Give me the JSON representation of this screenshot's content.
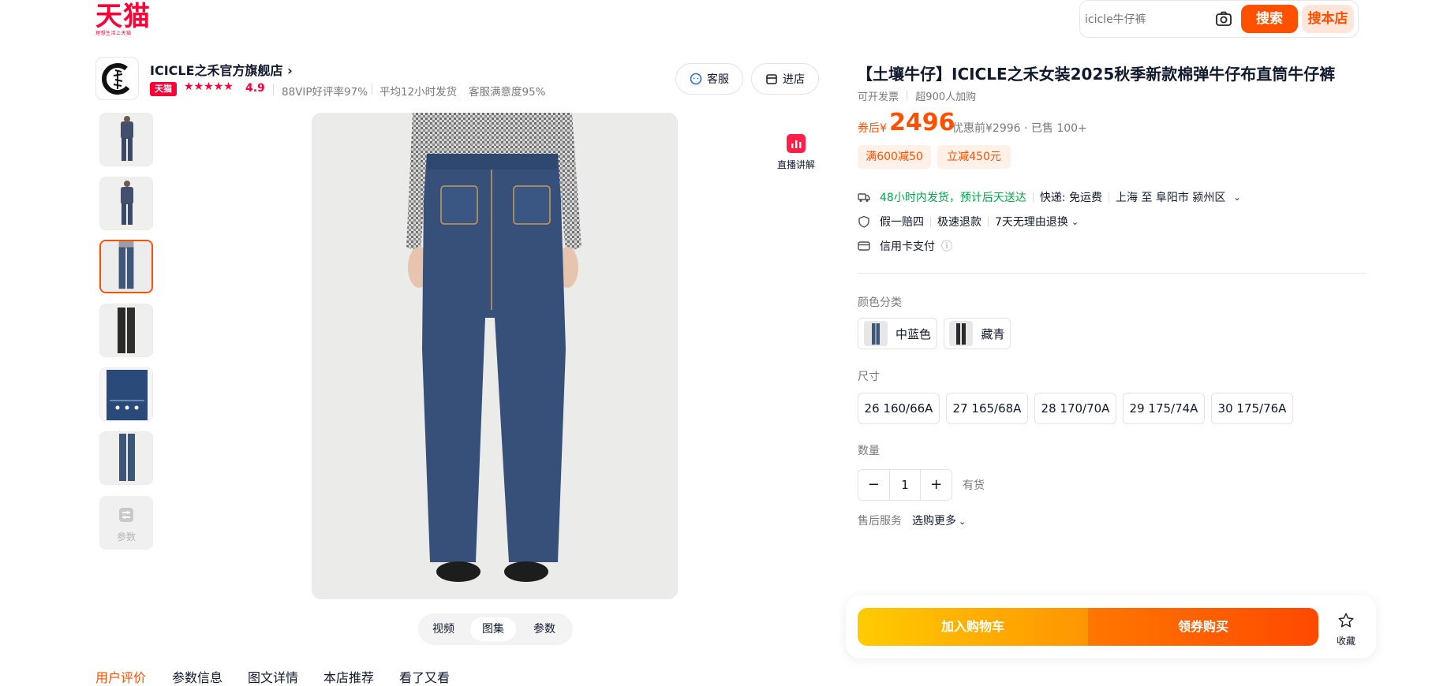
{
  "header": {
    "logo_text": "天猫",
    "logo_sub": "理想生活上天猫",
    "search_placeholder": "icicle牛仔裤",
    "search_button": "搜索",
    "store_search_button": "搜本店"
  },
  "shop": {
    "name": "ICICLE之禾官方旗舰店",
    "name_arrow": "›",
    "badge": "天猫",
    "stars": "★★★★★",
    "rating": "4.9",
    "stats": [
      "88VIP好评率97%",
      "平均12小时发货",
      "客服满意度95%"
    ],
    "service_button": "客服",
    "enter_button": "进店"
  },
  "gallery": {
    "param_thumb_label": "参数",
    "live_label": "直播讲解",
    "tabs": [
      "视频",
      "图集",
      "参数"
    ],
    "active_tab": "图集"
  },
  "bottom_tabs": [
    "用户评价",
    "参数信息",
    "图文详情",
    "本店推荐",
    "看了又看"
  ],
  "product": {
    "title": "【土壤牛仔】ICICLE之禾女装2025秋季新款棉弹牛仔布直筒牛仔裤",
    "invoice": "可开发票",
    "cart_count": "超900人加购",
    "price_prefix": "券后¥",
    "price": "2496",
    "price_old": "优惠前¥2996 · 已售 100+",
    "coupons": [
      "满600减50",
      "立减450元"
    ]
  },
  "services": {
    "shipping": "48小时内发货，预计后天送达",
    "delivery_fee": "快递: 免运费",
    "route": "上海 至 阜阳市 颍州区",
    "guarantee": [
      "假一赔四",
      "极速退款",
      "7天无理由退换"
    ],
    "payment": "信用卡支付",
    "info_icon": "ⓘ"
  },
  "options": {
    "color_label": "颜色分类",
    "colors": [
      "中蓝色",
      "藏青"
    ],
    "size_label": "尺寸",
    "sizes": [
      "26 160/66A",
      "27 165/68A",
      "28 170/70A",
      "29 175/74A",
      "30 175/76A"
    ],
    "qty_label": "数量",
    "qty_minus": "−",
    "qty_value": "1",
    "qty_plus": "+",
    "stock": "有货",
    "after_sale_label": "售后服务",
    "after_sale_value": "选购更多"
  },
  "actions": {
    "add_to_cart": "加入购物车",
    "buy_with_coupon": "领券购买",
    "favorite": "收藏"
  },
  "colors": {
    "brand": "#ff0036",
    "accent": "#ff5000",
    "green": "#00a84c"
  }
}
